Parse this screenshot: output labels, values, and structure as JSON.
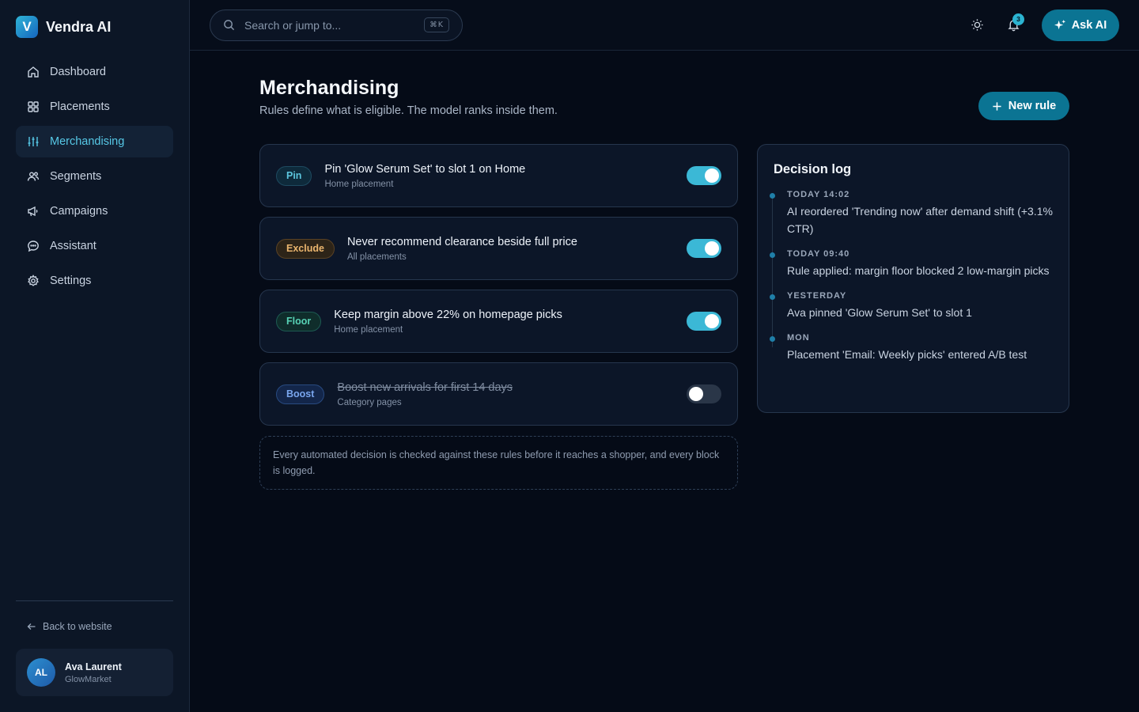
{
  "brand": {
    "name": "Vendra AI",
    "logo_letter": "V"
  },
  "sidebar": {
    "items": [
      {
        "label": "Dashboard",
        "icon": "home-icon",
        "active": false
      },
      {
        "label": "Placements",
        "icon": "grid-icon",
        "active": false
      },
      {
        "label": "Merchandising",
        "icon": "sliders-icon",
        "active": true
      },
      {
        "label": "Segments",
        "icon": "users-icon",
        "active": false
      },
      {
        "label": "Campaigns",
        "icon": "megaphone-icon",
        "active": false
      },
      {
        "label": "Assistant",
        "icon": "chat-icon",
        "active": false
      },
      {
        "label": "Settings",
        "icon": "gear-icon",
        "active": false
      }
    ],
    "back_link": "Back to website",
    "user": {
      "initials": "AL",
      "name": "Ava Laurent",
      "org": "GlowMarket"
    }
  },
  "topbar": {
    "search_placeholder": "Search or jump to...",
    "search_shortcut": "⌘K",
    "notification_count": "3",
    "ask_ai_label": "Ask AI"
  },
  "page": {
    "title": "Merchandising",
    "subtitle": "Rules define what is eligible. The model ranks inside them.",
    "new_rule_label": "New rule"
  },
  "rules": [
    {
      "tag": "Pin",
      "tag_class": "pin",
      "title": "Pin 'Glow Serum Set' to slot 1 on Home",
      "scope": "Home placement",
      "enabled": true
    },
    {
      "tag": "Exclude",
      "tag_class": "exclude",
      "title": "Never recommend clearance beside full price",
      "scope": "All placements",
      "enabled": true
    },
    {
      "tag": "Floor",
      "tag_class": "floor",
      "title": "Keep margin above 22% on homepage picks",
      "scope": "Home placement",
      "enabled": true
    },
    {
      "tag": "Boost",
      "tag_class": "boost",
      "title": "Boost new arrivals for first 14 days",
      "scope": "Category pages",
      "enabled": false
    }
  ],
  "note": "Every automated decision is checked against these rules before it reaches a shopper, and every block is logged.",
  "decision_log": {
    "title": "Decision log",
    "entries": [
      {
        "time": "TODAY 14:02",
        "text": "AI reordered 'Trending now' after demand shift (+3.1% CTR)"
      },
      {
        "time": "TODAY 09:40",
        "text": "Rule applied: margin floor blocked 2 low-margin picks"
      },
      {
        "time": "YESTERDAY",
        "text": "Ava pinned 'Glow Serum Set' to slot 1"
      },
      {
        "time": "MON",
        "text": "Placement 'Email: Weekly picks' entered A/B test"
      }
    ]
  },
  "colors": {
    "accent": "#3bb8d6",
    "primary_button": "#0b7493",
    "background": "#050b17",
    "sidebar": "#0c1626"
  }
}
